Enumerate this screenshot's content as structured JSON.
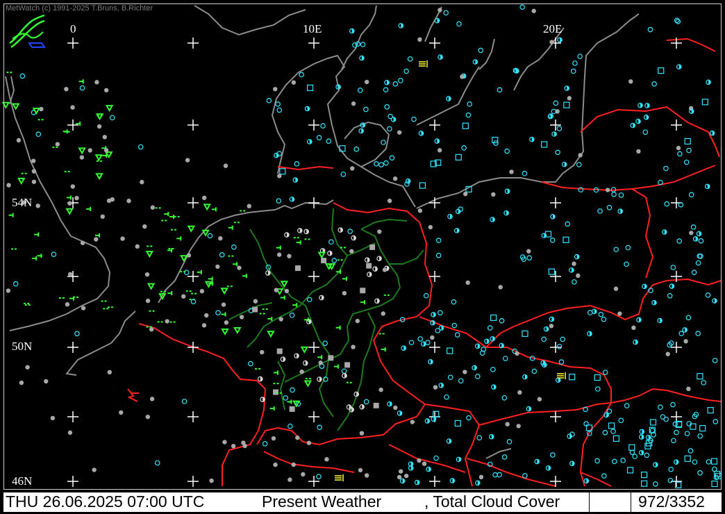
{
  "header": {
    "copyright": "MetWatch  (c) 1991-2025 T.Bruns, B.Richter"
  },
  "grid_labels": {
    "lon_0": "0",
    "lon_10e": "10E",
    "lon_20e": "20E",
    "lat_54n": "54N",
    "lat_50n": "50N",
    "lat_46n": "46N"
  },
  "status_bar": {
    "datetime": "THU 26.06.2025 07:00 UTC",
    "product": "Present Weather",
    "overlay": ", Total Cloud Cover",
    "count": "972/3352"
  },
  "colors": {
    "background": "#000000",
    "coastline": "#8c8c8c",
    "borders": "#ff2020",
    "german_states": "#1e7a1e",
    "precip_symbol": "#33ff33",
    "cloud_symbol": "#33e6ff",
    "station_dot": "#a8a8a8",
    "fog_symbol": "#ffff33",
    "grid_cross": "#ffffff"
  },
  "icons": {
    "logo": "metwatch-logo-icon"
  }
}
